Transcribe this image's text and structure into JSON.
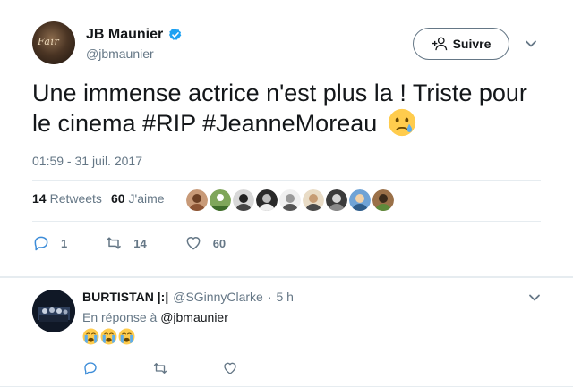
{
  "tweet": {
    "author_name": "JB Maunier",
    "author_handle": "@jbmaunier",
    "avatar_text": "Fair",
    "follow_label": "Suivre",
    "text": "Une immense actrice n'est plus la ! Triste pour le cinema #RIP #JeanneMoreau",
    "timestamp": "01:59 - 31 juil. 2017",
    "retweets_count": "14",
    "retweets_label": "Retweets",
    "likes_count": "60",
    "likes_label": "J'aime",
    "actions": {
      "reply_count": "1",
      "retweet_count": "14",
      "like_count": "60"
    },
    "likers": [
      "#a0704a",
      "#5b8a3c",
      "#3a3a3a",
      "#2d2d2d",
      "#7a7a7a",
      "#c9a27a",
      "#4a4a4a",
      "#3d6b9a",
      "#7b5a3a"
    ],
    "icons": [
      "verified-icon",
      "follow-user-icon",
      "chevron-down-icon",
      "crying-face-icon",
      "reply-icon",
      "retweet-icon",
      "heart-icon"
    ]
  },
  "reply": {
    "author_name": "BURTISTAN |:|",
    "author_handle": "@SGinnyClarke",
    "dot": "·",
    "time": "5 h",
    "context_prefix": "En réponse à",
    "context_mention": "@jbmaunier",
    "emoji_count": 3
  },
  "colors": {
    "text_primary": "#14171a",
    "text_secondary": "#657786",
    "verified_blue": "#1da1f2",
    "divider": "#e6ecf0"
  }
}
